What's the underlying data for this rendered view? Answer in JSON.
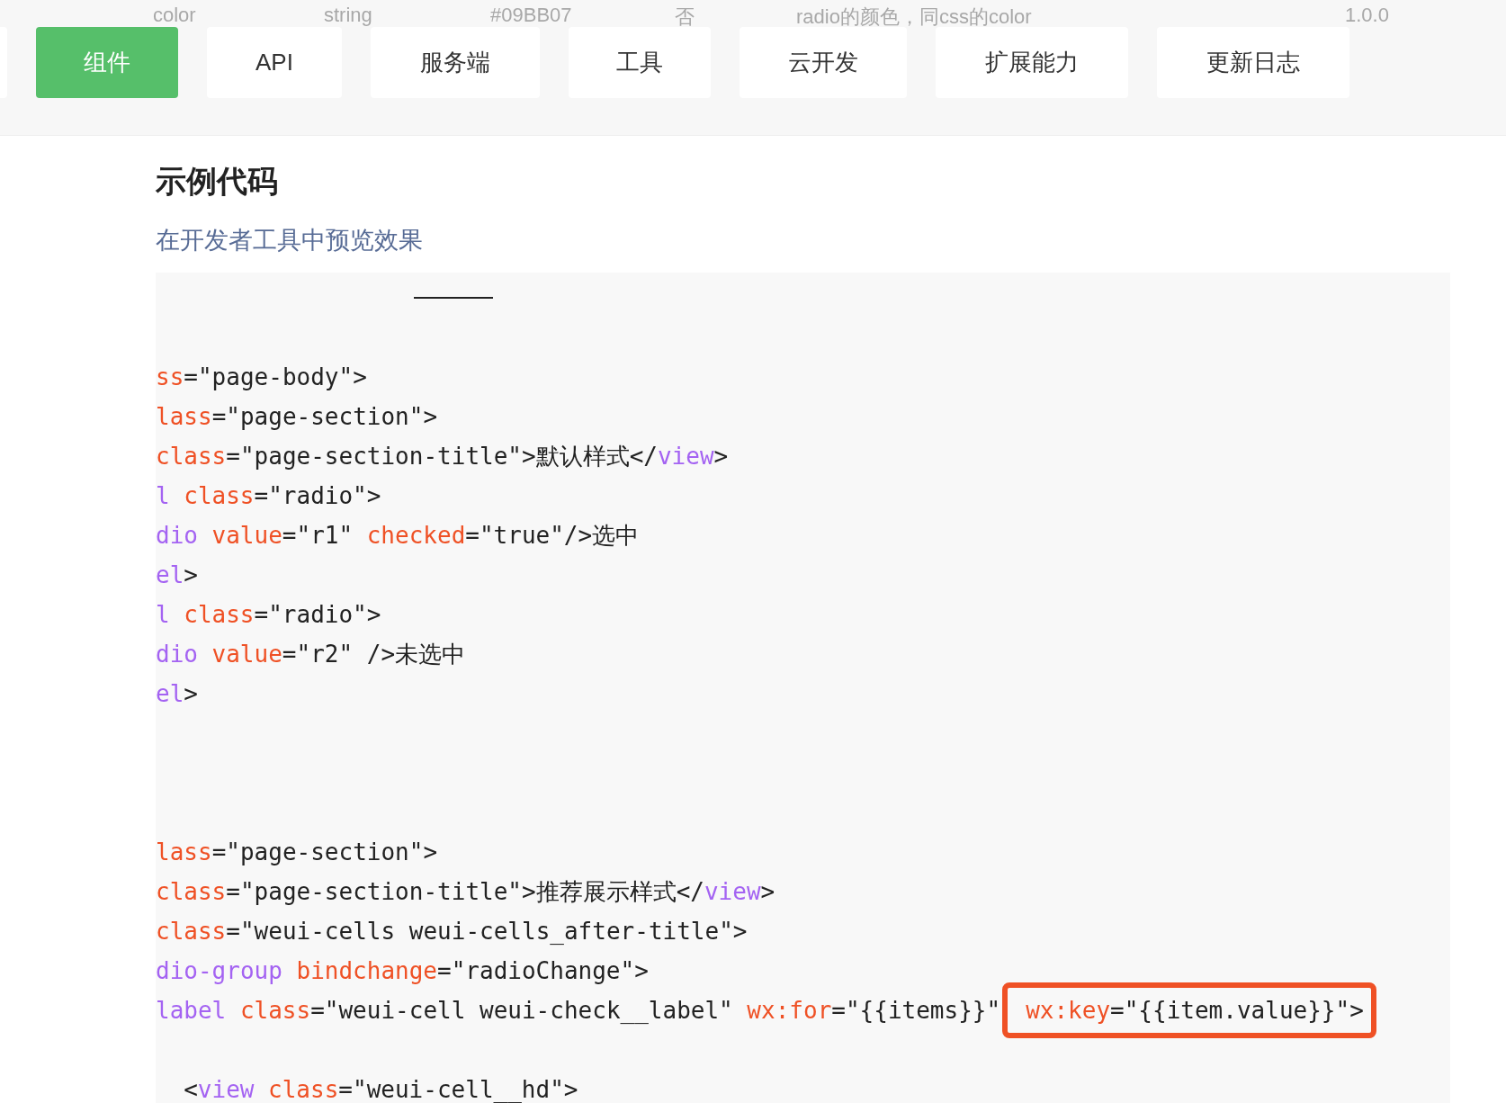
{
  "background_row": [
    "color",
    "string",
    "#09BB07",
    "否",
    "radio的颜色，同css的color",
    "1.0.0"
  ],
  "nav_tabs": [
    {
      "selected": false
    },
    {
      "label": "组件",
      "selected": true
    },
    {
      "label": "API",
      "selected": false
    },
    {
      "label": "服务端",
      "selected": false
    },
    {
      "label": "工具",
      "selected": false
    },
    {
      "label": "云开发",
      "selected": false
    },
    {
      "label": "扩展能力",
      "selected": false
    },
    {
      "label": "更新日志",
      "selected": false
    }
  ],
  "section_title": "示例代码",
  "preview_link": "在开发者工具中预览效果",
  "code_lines": [
    {
      "kind": "rule"
    },
    {
      "kind": "blank"
    },
    {
      "kind": "code",
      "tokens": [
        {
          "kind": "attr",
          "text": "ss"
        },
        {
          "kind": "plain",
          "text": "=\"page-body\">"
        }
      ]
    },
    {
      "kind": "code",
      "tokens": [
        {
          "kind": "attr",
          "text": "lass"
        },
        {
          "kind": "plain",
          "text": "=\"page-section\">"
        }
      ]
    },
    {
      "kind": "code",
      "tokens": [
        {
          "kind": "attr",
          "text": "class"
        },
        {
          "kind": "plain",
          "text": "=\"page-section-title\">默认样式</"
        },
        {
          "kind": "tag",
          "text": "view"
        },
        {
          "kind": "plain",
          "text": ">"
        }
      ]
    },
    {
      "kind": "code",
      "tokens": [
        {
          "kind": "tag",
          "text": "l"
        },
        {
          "kind": "attr",
          "text": "class"
        },
        {
          "kind": "plain",
          "text": "=\"radio\">"
        }
      ]
    },
    {
      "kind": "code",
      "tokens": [
        {
          "kind": "tag",
          "text": "dio"
        },
        {
          "kind": "attr",
          "text": "value"
        },
        {
          "kind": "plain",
          "text": "=\"r1\""
        },
        {
          "kind": "attr",
          "text": "checked"
        },
        {
          "kind": "plain",
          "text": "=\"true\"/>选中"
        }
      ]
    },
    {
      "kind": "code",
      "tokens": [
        {
          "kind": "tag",
          "text": "el"
        },
        {
          "kind": "plain",
          "text": ">"
        }
      ]
    },
    {
      "kind": "code",
      "tokens": [
        {
          "kind": "tag",
          "text": "l"
        },
        {
          "kind": "attr",
          "text": "class"
        },
        {
          "kind": "plain",
          "text": "=\"radio\">"
        }
      ]
    },
    {
      "kind": "code",
      "tokens": [
        {
          "kind": "tag",
          "text": "dio"
        },
        {
          "kind": "attr",
          "text": "value"
        },
        {
          "kind": "plain",
          "text": "=\"r2\" />未选中"
        }
      ]
    },
    {
      "kind": "code",
      "tokens": [
        {
          "kind": "tag",
          "text": "el"
        },
        {
          "kind": "plain",
          "text": ">"
        }
      ]
    },
    {
      "kind": "blank"
    },
    {
      "kind": "blank"
    },
    {
      "kind": "blank"
    },
    {
      "kind": "code",
      "tokens": [
        {
          "kind": "attr",
          "text": "lass"
        },
        {
          "kind": "plain",
          "text": "=\"page-section\">"
        }
      ]
    },
    {
      "kind": "code",
      "tokens": [
        {
          "kind": "attr",
          "text": "class"
        },
        {
          "kind": "plain",
          "text": "=\"page-section-title\">推荐展示样式</"
        },
        {
          "kind": "tag",
          "text": "view"
        },
        {
          "kind": "plain",
          "text": ">"
        }
      ]
    },
    {
      "kind": "code",
      "tokens": [
        {
          "kind": "attr",
          "text": "class"
        },
        {
          "kind": "plain",
          "text": "=\"weui-cells weui-cells_after-title\">"
        }
      ]
    },
    {
      "kind": "code",
      "tokens": [
        {
          "kind": "tag",
          "text": "dio-group"
        },
        {
          "kind": "attr",
          "text": "bindchange"
        },
        {
          "kind": "plain",
          "text": "=\"radioChange\">"
        }
      ]
    },
    {
      "kind": "code",
      "tokens": [
        {
          "kind": "tag",
          "text": "label"
        },
        {
          "kind": "attr",
          "text": "class"
        },
        {
          "kind": "plain",
          "text": "=\"weui-cell weui-check__label\""
        },
        {
          "kind": "attr",
          "text": "wx:for"
        },
        {
          "kind": "plain",
          "text": "=\"{{items}}\""
        },
        {
          "kind": "attr",
          "text": "wx:key",
          "boxed": true
        },
        {
          "kind": "plain",
          "text": "=\"{{item.value}}\">",
          "boxed": true
        }
      ]
    },
    {
      "kind": "blank"
    },
    {
      "kind": "code",
      "tokens": [
        {
          "kind": "plain",
          "text": "<"
        },
        {
          "kind": "tag",
          "text": "view"
        },
        {
          "kind": "attr",
          "text": "class"
        },
        {
          "kind": "plain",
          "text": "=\"weui-cell__hd\">"
        }
      ],
      "indented": true
    }
  ]
}
